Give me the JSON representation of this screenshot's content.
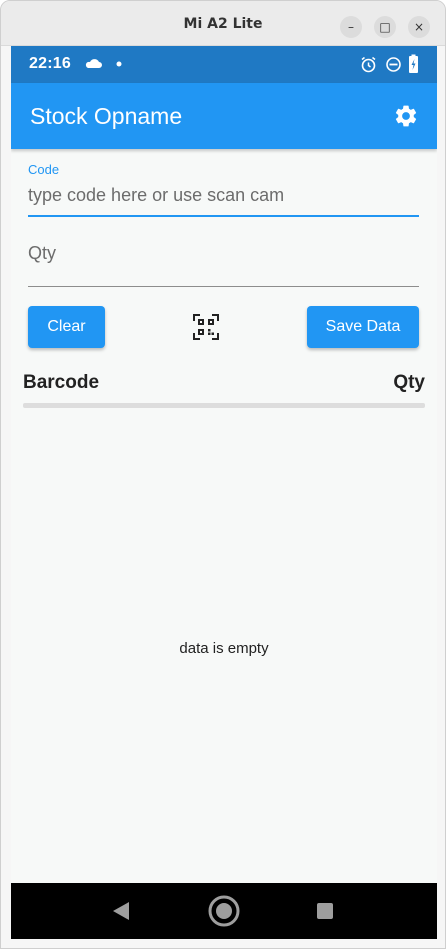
{
  "window": {
    "title": "Mi A2 Lite",
    "controls": {
      "minimize": "–",
      "maximize": "□",
      "close": "×"
    }
  },
  "status_bar": {
    "time": "22:16",
    "icons": [
      "cloud-icon",
      "dot-icon",
      "alarm-icon",
      "do-not-disturb-icon",
      "battery-charging-icon"
    ]
  },
  "app_bar": {
    "title": "Stock Opname",
    "action_icon": "settings-gear-icon"
  },
  "form": {
    "code_label": "Code",
    "code_placeholder": "type code here or use scan cam",
    "code_value": "",
    "qty_placeholder": "Qty",
    "qty_value": ""
  },
  "actions": {
    "clear_label": "Clear",
    "scan_icon": "qr-scan-icon",
    "save_label": "Save Data"
  },
  "table": {
    "columns": [
      "Barcode",
      "Qty"
    ],
    "rows": [],
    "empty_message": "data is empty"
  },
  "nav_bar": {
    "buttons": [
      "back-icon",
      "home-icon",
      "recents-icon"
    ]
  },
  "colors": {
    "primary": "#2196f3",
    "status_bar": "#1f79c4",
    "background": "#f7f9f8",
    "nav_bar": "#000000"
  }
}
